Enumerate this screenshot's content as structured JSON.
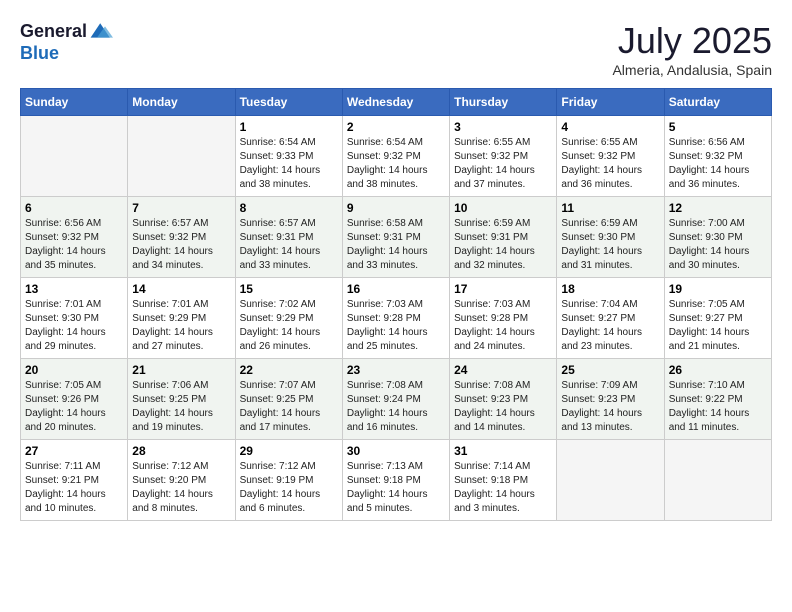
{
  "logo": {
    "general": "General",
    "blue": "Blue"
  },
  "title": "July 2025",
  "subtitle": "Almeria, Andalusia, Spain",
  "days_of_week": [
    "Sunday",
    "Monday",
    "Tuesday",
    "Wednesday",
    "Thursday",
    "Friday",
    "Saturday"
  ],
  "weeks": [
    [
      {
        "day": "",
        "empty": true
      },
      {
        "day": "",
        "empty": true
      },
      {
        "day": "1",
        "sunrise": "6:54 AM",
        "sunset": "9:33 PM",
        "daylight": "14 hours and 38 minutes."
      },
      {
        "day": "2",
        "sunrise": "6:54 AM",
        "sunset": "9:32 PM",
        "daylight": "14 hours and 38 minutes."
      },
      {
        "day": "3",
        "sunrise": "6:55 AM",
        "sunset": "9:32 PM",
        "daylight": "14 hours and 37 minutes."
      },
      {
        "day": "4",
        "sunrise": "6:55 AM",
        "sunset": "9:32 PM",
        "daylight": "14 hours and 36 minutes."
      },
      {
        "day": "5",
        "sunrise": "6:56 AM",
        "sunset": "9:32 PM",
        "daylight": "14 hours and 36 minutes."
      }
    ],
    [
      {
        "day": "6",
        "sunrise": "6:56 AM",
        "sunset": "9:32 PM",
        "daylight": "14 hours and 35 minutes."
      },
      {
        "day": "7",
        "sunrise": "6:57 AM",
        "sunset": "9:32 PM",
        "daylight": "14 hours and 34 minutes."
      },
      {
        "day": "8",
        "sunrise": "6:57 AM",
        "sunset": "9:31 PM",
        "daylight": "14 hours and 33 minutes."
      },
      {
        "day": "9",
        "sunrise": "6:58 AM",
        "sunset": "9:31 PM",
        "daylight": "14 hours and 33 minutes."
      },
      {
        "day": "10",
        "sunrise": "6:59 AM",
        "sunset": "9:31 PM",
        "daylight": "14 hours and 32 minutes."
      },
      {
        "day": "11",
        "sunrise": "6:59 AM",
        "sunset": "9:30 PM",
        "daylight": "14 hours and 31 minutes."
      },
      {
        "day": "12",
        "sunrise": "7:00 AM",
        "sunset": "9:30 PM",
        "daylight": "14 hours and 30 minutes."
      }
    ],
    [
      {
        "day": "13",
        "sunrise": "7:01 AM",
        "sunset": "9:30 PM",
        "daylight": "14 hours and 29 minutes."
      },
      {
        "day": "14",
        "sunrise": "7:01 AM",
        "sunset": "9:29 PM",
        "daylight": "14 hours and 27 minutes."
      },
      {
        "day": "15",
        "sunrise": "7:02 AM",
        "sunset": "9:29 PM",
        "daylight": "14 hours and 26 minutes."
      },
      {
        "day": "16",
        "sunrise": "7:03 AM",
        "sunset": "9:28 PM",
        "daylight": "14 hours and 25 minutes."
      },
      {
        "day": "17",
        "sunrise": "7:03 AM",
        "sunset": "9:28 PM",
        "daylight": "14 hours and 24 minutes."
      },
      {
        "day": "18",
        "sunrise": "7:04 AM",
        "sunset": "9:27 PM",
        "daylight": "14 hours and 23 minutes."
      },
      {
        "day": "19",
        "sunrise": "7:05 AM",
        "sunset": "9:27 PM",
        "daylight": "14 hours and 21 minutes."
      }
    ],
    [
      {
        "day": "20",
        "sunrise": "7:05 AM",
        "sunset": "9:26 PM",
        "daylight": "14 hours and 20 minutes."
      },
      {
        "day": "21",
        "sunrise": "7:06 AM",
        "sunset": "9:25 PM",
        "daylight": "14 hours and 19 minutes."
      },
      {
        "day": "22",
        "sunrise": "7:07 AM",
        "sunset": "9:25 PM",
        "daylight": "14 hours and 17 minutes."
      },
      {
        "day": "23",
        "sunrise": "7:08 AM",
        "sunset": "9:24 PM",
        "daylight": "14 hours and 16 minutes."
      },
      {
        "day": "24",
        "sunrise": "7:08 AM",
        "sunset": "9:23 PM",
        "daylight": "14 hours and 14 minutes."
      },
      {
        "day": "25",
        "sunrise": "7:09 AM",
        "sunset": "9:23 PM",
        "daylight": "14 hours and 13 minutes."
      },
      {
        "day": "26",
        "sunrise": "7:10 AM",
        "sunset": "9:22 PM",
        "daylight": "14 hours and 11 minutes."
      }
    ],
    [
      {
        "day": "27",
        "sunrise": "7:11 AM",
        "sunset": "9:21 PM",
        "daylight": "14 hours and 10 minutes."
      },
      {
        "day": "28",
        "sunrise": "7:12 AM",
        "sunset": "9:20 PM",
        "daylight": "14 hours and 8 minutes."
      },
      {
        "day": "29",
        "sunrise": "7:12 AM",
        "sunset": "9:19 PM",
        "daylight": "14 hours and 6 minutes."
      },
      {
        "day": "30",
        "sunrise": "7:13 AM",
        "sunset": "9:18 PM",
        "daylight": "14 hours and 5 minutes."
      },
      {
        "day": "31",
        "sunrise": "7:14 AM",
        "sunset": "9:18 PM",
        "daylight": "14 hours and 3 minutes."
      },
      {
        "day": "",
        "empty": true
      },
      {
        "day": "",
        "empty": true
      }
    ]
  ]
}
